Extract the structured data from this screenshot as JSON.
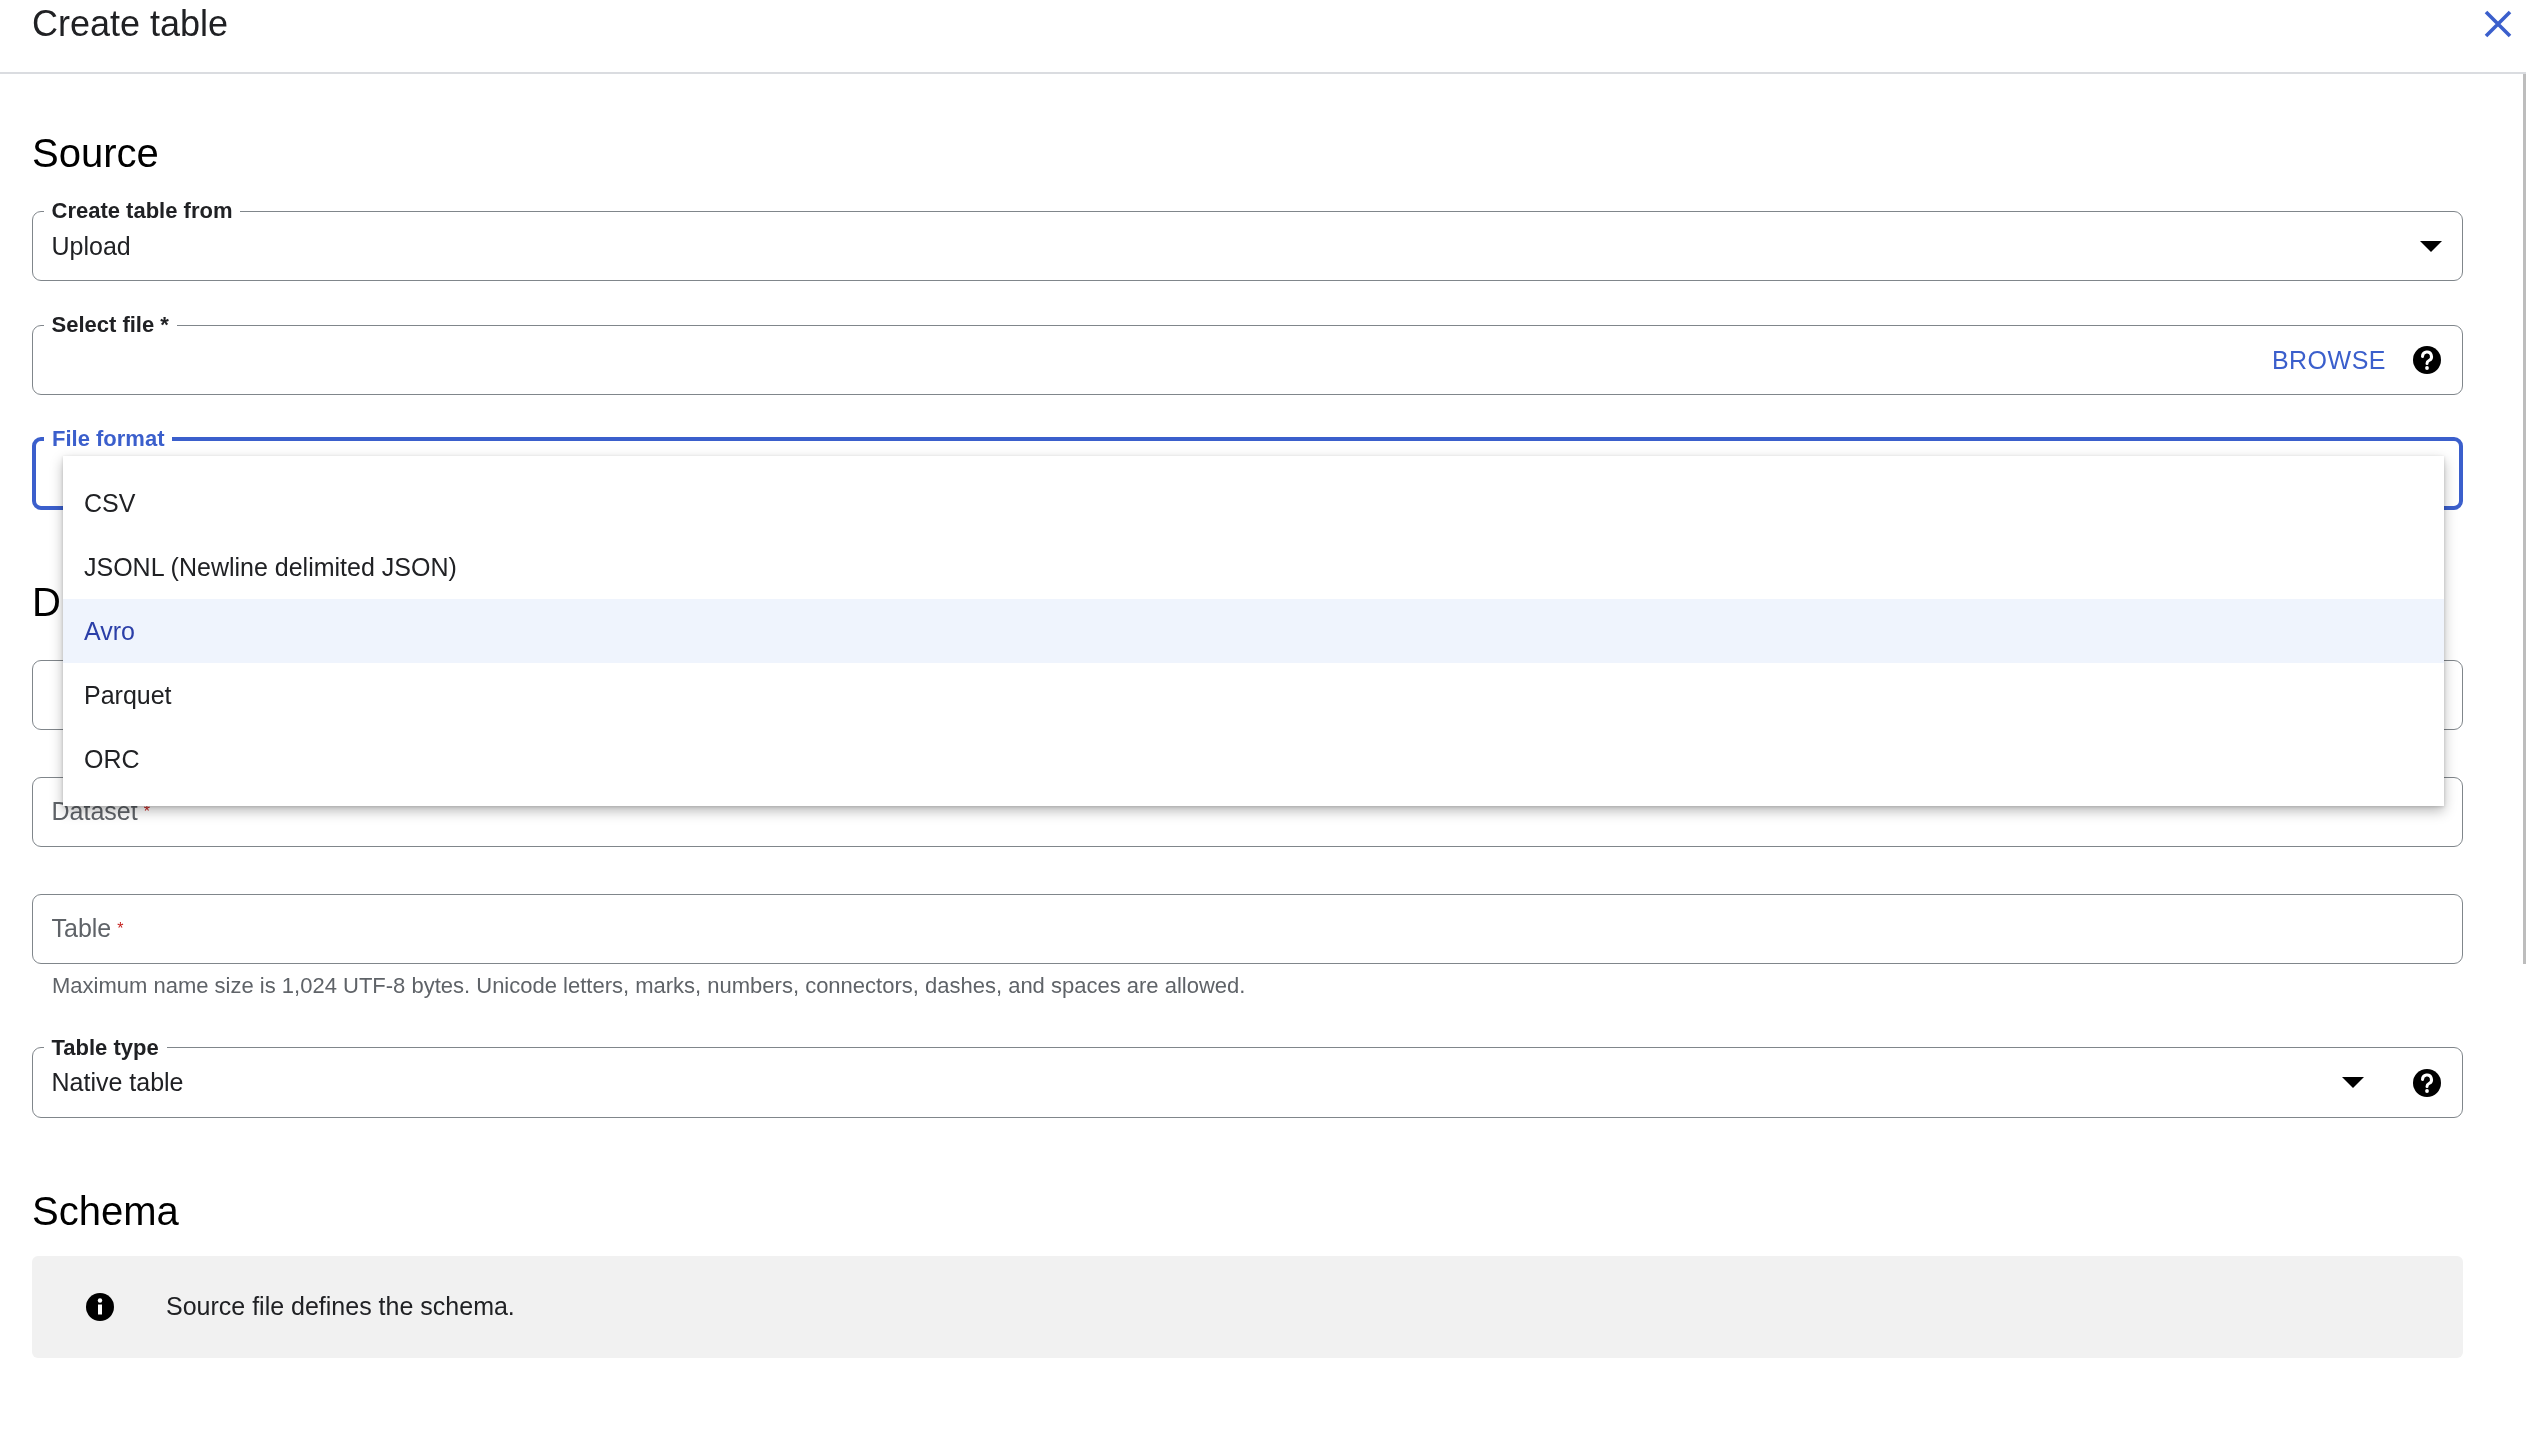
{
  "dialog": {
    "title": "Create table"
  },
  "sections": [
    {
      "heading": "Source",
      "fields": [
        {
          "kind": "select",
          "label": "Create table from",
          "value": "Upload",
          "help": false,
          "focused": false
        },
        {
          "kind": "file",
          "label": "Select file *",
          "action": "BROWSE",
          "help": true,
          "focused": false
        },
        {
          "kind": "select",
          "label": "File format",
          "help": false,
          "focused": true,
          "menu": [
            {
              "label": "CSV",
              "selected": false
            },
            {
              "label": "JSONL (Newline delimited JSON)",
              "selected": false
            },
            {
              "label": "Avro",
              "selected": true
            },
            {
              "label": "Parquet",
              "selected": false
            },
            {
              "label": "ORC",
              "selected": false
            }
          ]
        }
      ]
    },
    {
      "heading": "D",
      "fields": [
        {
          "kind": "text",
          "help": false,
          "focused": false
        },
        {
          "kind": "text",
          "placeholder": "Dataset",
          "required_mark": "*",
          "help": false,
          "focused": false
        },
        {
          "kind": "text",
          "placeholder": "Table",
          "required_mark": "*",
          "helper": "Maximum name size is 1,024 UTF-8 bytes. Unicode letters, marks, numbers, connectors, dashes, and spaces are allowed.",
          "help": false,
          "focused": false
        },
        {
          "kind": "select",
          "label": "Table type",
          "value": "Native table",
          "help": true,
          "focused": false
        }
      ]
    },
    {
      "heading": "Schema",
      "info": "Source file defines the schema."
    }
  ]
}
